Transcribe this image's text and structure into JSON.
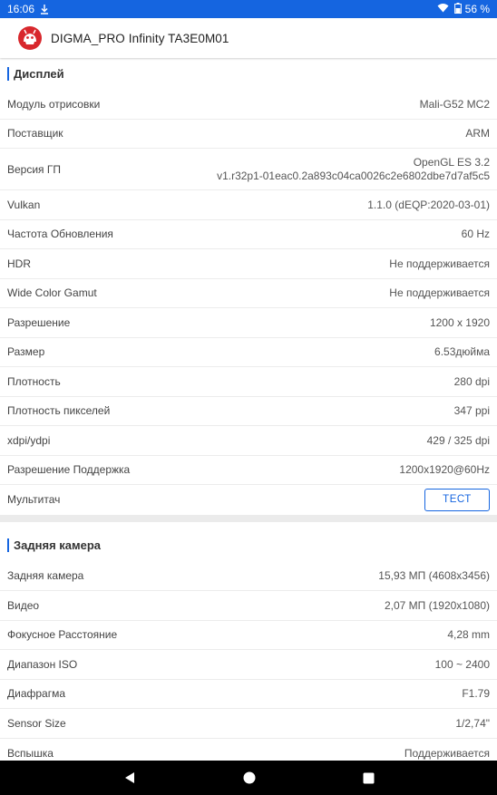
{
  "status_bar": {
    "time": "16:06",
    "battery": "56 %",
    "icons": [
      "download-icon",
      "wifi-icon",
      "battery-icon"
    ]
  },
  "app_bar": {
    "title": "DIGMA_PRO Infinity TA3E0M01",
    "logo": "antutu-logo-icon"
  },
  "display": {
    "title": "Дисплей",
    "rows": [
      {
        "label": "Модуль отрисовки",
        "value": "Mali-G52 MC2"
      },
      {
        "label": "Поставщик",
        "value": "ARM"
      },
      {
        "label": "Версия ГП",
        "value_lines": [
          "OpenGL ES 3.2",
          "v1.r32p1-01eac0.2a893c04ca0026c2e6802dbe7d7af5c5"
        ]
      },
      {
        "label": "Vulkan",
        "value": "1.1.0 (dEQP:2020-03-01)"
      },
      {
        "label": "Частота Обновления",
        "value": "60 Hz"
      },
      {
        "label": "HDR",
        "value": "Не поддерживается"
      },
      {
        "label": "Wide Color Gamut",
        "value": "Не поддерживается"
      },
      {
        "label": "Разрешение",
        "value": "1200 x 1920"
      },
      {
        "label": "Размер",
        "value": "6.53дюйма"
      },
      {
        "label": "Плотность",
        "value": "280 dpi"
      },
      {
        "label": "Плотность пикселей",
        "value": "347 ppi"
      },
      {
        "label": "xdpi/ydpi",
        "value": "429 / 325 dpi"
      },
      {
        "label": "Разрешение Поддержка",
        "value": "1200x1920@60Hz"
      },
      {
        "label": "Мультитач",
        "button": "ТЕСТ"
      }
    ]
  },
  "camera": {
    "title": "Задняя камера",
    "rows": [
      {
        "label": "Задняя камера",
        "value": "15,93 МП (4608x3456)"
      },
      {
        "label": "Видео",
        "value": "2,07 МП (1920x1080)"
      },
      {
        "label": "Фокусное Расстояние",
        "value": "4,28 mm"
      },
      {
        "label": "Диапазон ISO",
        "value": "100 ~ 2400"
      },
      {
        "label": "Диафрагма",
        "value": "F1.79"
      },
      {
        "label": "Sensor Size",
        "value": "1/2,74\""
      },
      {
        "label": "Вспышка",
        "value": "Поддерживается"
      }
    ]
  },
  "nav_bar": {
    "icons": [
      "back-icon",
      "home-icon",
      "recents-icon"
    ]
  },
  "colors": {
    "accent": "#1565e0",
    "status_bar": "#1565e0",
    "nav_bar": "#000000",
    "divider": "#ebebeb"
  }
}
